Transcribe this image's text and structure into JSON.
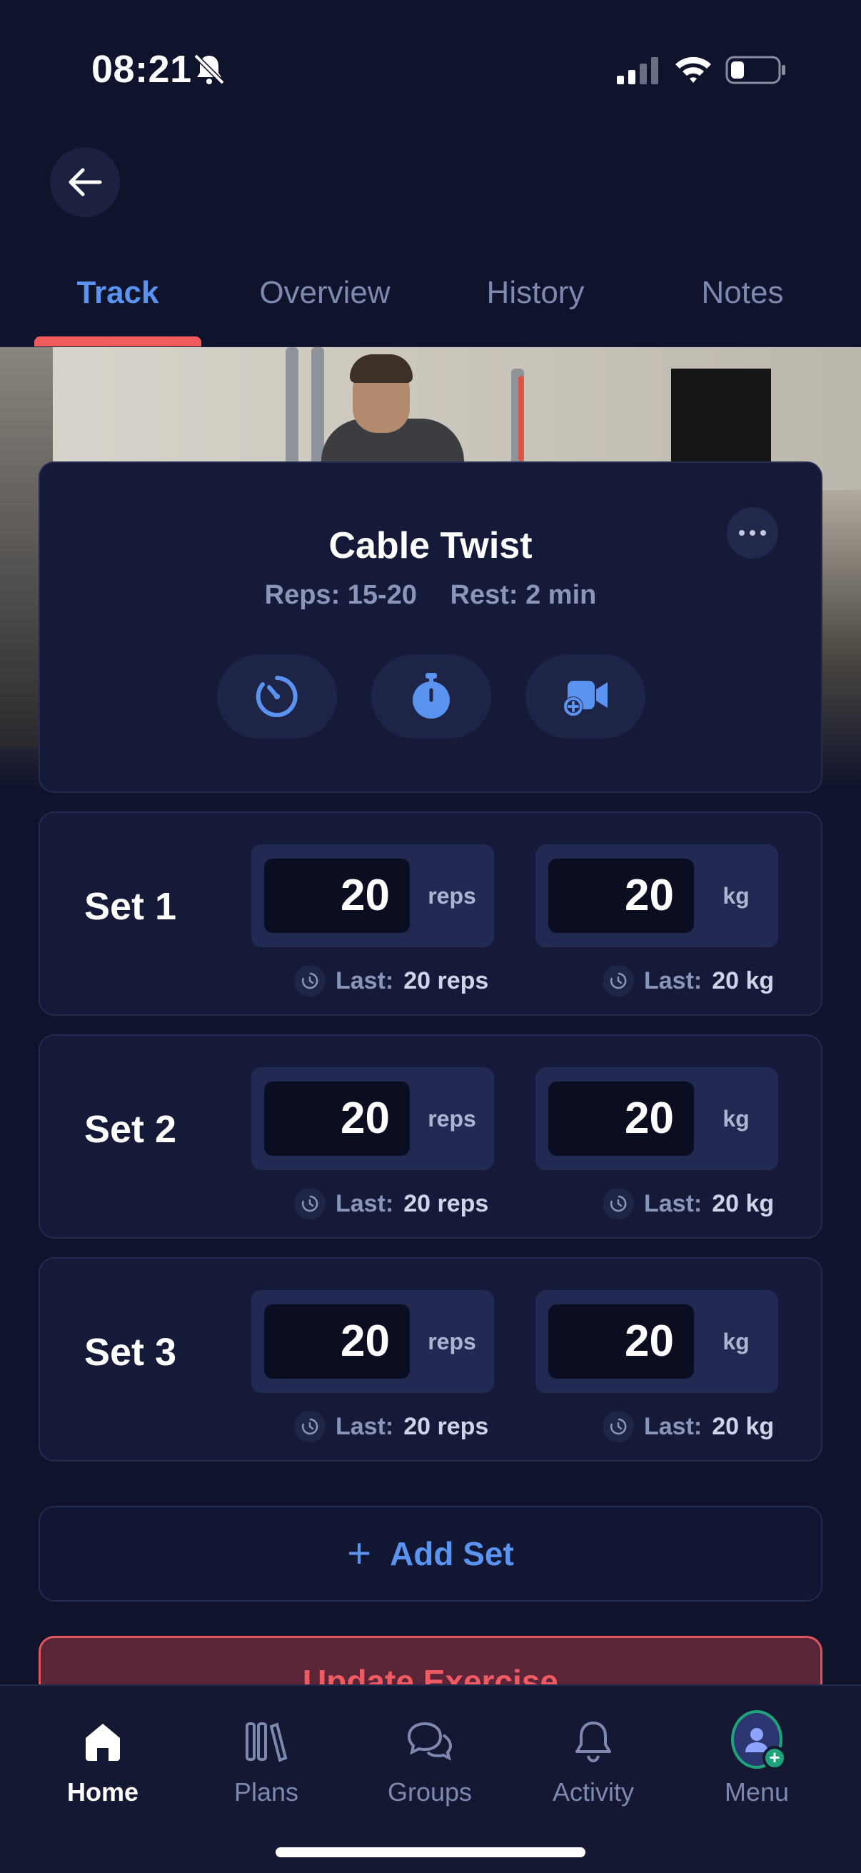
{
  "status_bar": {
    "time": "08:21"
  },
  "tabs": [
    {
      "label": "Track",
      "active": true
    },
    {
      "label": "Overview",
      "active": false
    },
    {
      "label": "History",
      "active": false
    },
    {
      "label": "Notes",
      "active": false
    }
  ],
  "exercise": {
    "title": "Cable Twist",
    "reps": "Reps: 15-20",
    "rest": "Rest: 2 min"
  },
  "sets": [
    {
      "label": "Set 1",
      "reps": "20",
      "reps_unit": "reps",
      "weight": "20",
      "weight_unit": "kg",
      "last_label": "Last:",
      "last_reps": "20 reps",
      "last_weight": "20 kg"
    },
    {
      "label": "Set 2",
      "reps": "20",
      "reps_unit": "reps",
      "weight": "20",
      "weight_unit": "kg",
      "last_label": "Last:",
      "last_reps": "20 reps",
      "last_weight": "20 kg"
    },
    {
      "label": "Set 3",
      "reps": "20",
      "reps_unit": "reps",
      "weight": "20",
      "weight_unit": "kg",
      "last_label": "Last:",
      "last_reps": "20 reps",
      "last_weight": "20 kg"
    }
  ],
  "add_set": {
    "label": "Add Set",
    "icon": "+"
  },
  "update_button": {
    "label": "Update Exercise"
  },
  "bottom_nav": [
    {
      "label": "Home",
      "icon": "home-icon",
      "active": true
    },
    {
      "label": "Plans",
      "icon": "plans-icon",
      "active": false
    },
    {
      "label": "Groups",
      "icon": "groups-icon",
      "active": false
    },
    {
      "label": "Activity",
      "icon": "bell-icon",
      "active": false
    },
    {
      "label": "Menu",
      "icon": "avatar-icon",
      "active": false
    }
  ],
  "colors": {
    "background": "#0f132c",
    "accent": "#5a93f0",
    "tab_indicator": "#f15b5b",
    "danger": "#f05a63"
  }
}
